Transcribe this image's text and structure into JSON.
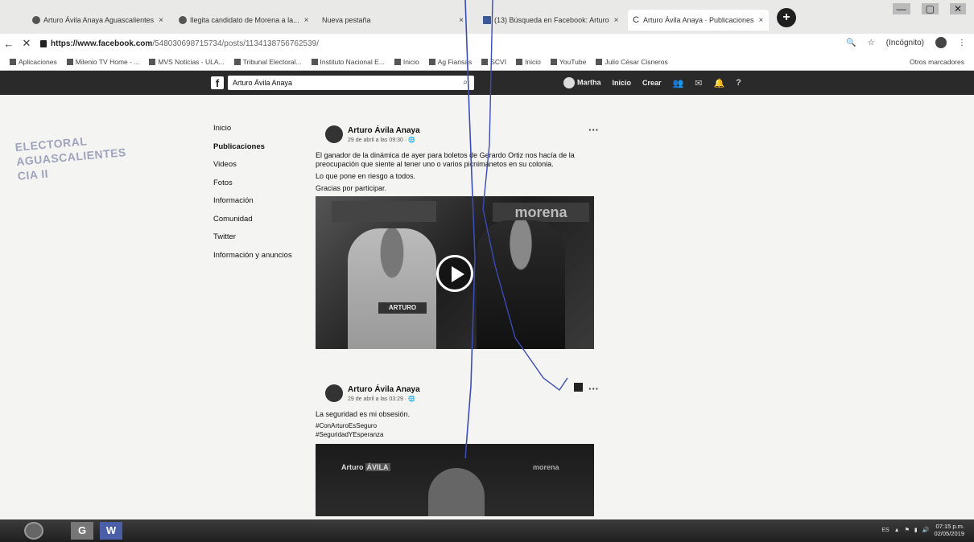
{
  "browser": {
    "tabs": [
      {
        "label": "Arturo Ávila Anaya Aguascalientes",
        "active": false
      },
      {
        "label": "Ilegita candidato de Morena a la...",
        "active": false
      },
      {
        "label": "Nueva pestaña",
        "active": false
      },
      {
        "label": "(13) Búsqueda en Facebook: Arturo",
        "active": false
      },
      {
        "label": "Arturo Ávila Anaya · Publicaciones",
        "active": true
      }
    ],
    "window_controls": [
      "—",
      "▢",
      "✕"
    ],
    "url_domain": "https://www.facebook.com",
    "url_path": "/548030698715734/posts/1134138756762539/",
    "address_right": {
      "profile_label": "(Incógnito)"
    },
    "bookmarks": [
      "Aplicaciones",
      "Milenio TV Home - ...",
      "MVS Noticias - ULA...",
      "Tribunal Electoral...",
      "Instituto Nacional E...",
      "Inicio",
      "Ag Fiansas",
      "SCVI",
      "Inicio",
      "YouTube",
      "Julio César Cisneros"
    ],
    "bookmarks_right": "Otros marcadores"
  },
  "facebook": {
    "logo": "f",
    "search_value": "Arturo Ávila Anaya",
    "nav": {
      "user": "Martha",
      "home": "Inicio",
      "create": "Crear"
    },
    "left_menu": [
      {
        "label": "Inicio",
        "bold": false
      },
      {
        "label": "Publicaciones",
        "bold": true
      },
      {
        "label": "Videos",
        "bold": false
      },
      {
        "label": "Fotos",
        "bold": false
      },
      {
        "label": "Información",
        "bold": false
      },
      {
        "label": "Comunidad",
        "bold": false
      },
      {
        "label": "Twitter",
        "bold": false
      },
      {
        "label": "Información y anuncios",
        "bold": false
      }
    ],
    "posts": [
      {
        "author": "Arturo Ávila Anaya",
        "meta": "29 de abril a las 09:30 · 🌐",
        "text": [
          "El ganador de la dinámica de ayer para boletos de Gerardo Ortiz nos hacía de la preocupación que siente al tener uno o varios picnimanetos en su colonia.",
          "Lo que pone en riesgo a todos.",
          "Gracias por participar."
        ],
        "video_overlay": {
          "sign_right": "morena",
          "shirt_label": "ARTURO"
        }
      },
      {
        "author": "Arturo Ávila Anaya",
        "meta": "29 de abril a las 03:29 · 🌐",
        "text": [
          "La seguridad es mi obsesión.",
          "#ConArturoEsSeguro",
          "#SeguridadYEsperanza"
        ],
        "video_overlay": {
          "badge_left": "Arturo",
          "badge_left_tag": "ÁVILA",
          "badge_right": "morena"
        }
      }
    ],
    "more_glyph": "···"
  },
  "stamp": {
    "lines": [
      "ELECTORAL",
      "AGUASCALIENTES",
      "CIA  II"
    ]
  },
  "taskbar": {
    "apps": [
      "G",
      "W"
    ],
    "time": "07:15 p.m.",
    "date": "02/05/2019"
  },
  "colors": {
    "fb_bar": "#2a2a2a",
    "stamp": "#8b8fb0",
    "pen": "#3b4bb8"
  }
}
